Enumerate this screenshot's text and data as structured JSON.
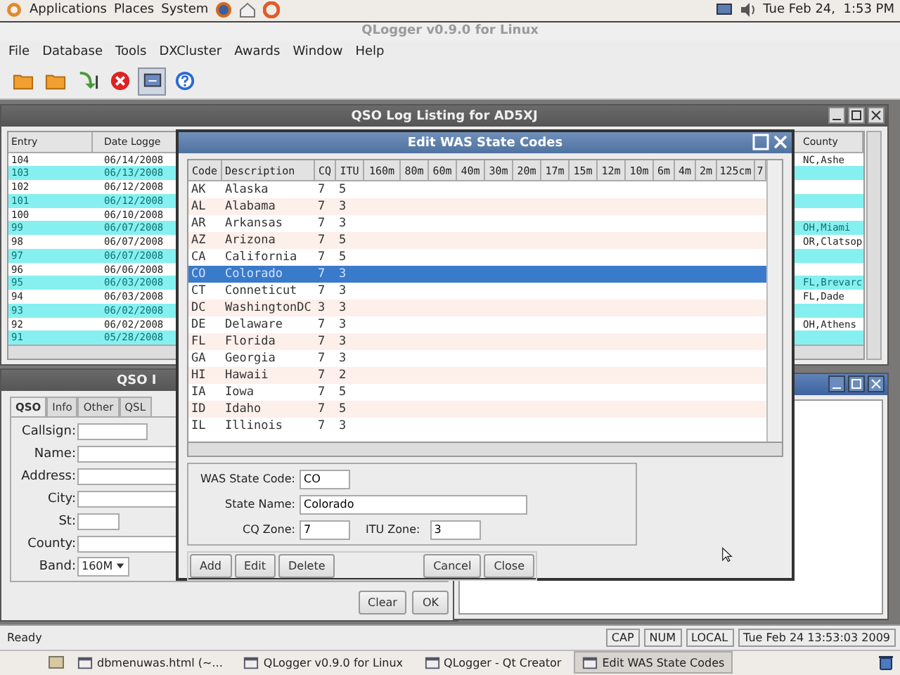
{
  "top_panel": {
    "menus": [
      "Applications",
      "Places",
      "System"
    ],
    "clock": "Tue Feb 24,  1:53 PM"
  },
  "app": {
    "title": "QLogger v0.9.0 for Linux",
    "menu": [
      "File",
      "Database",
      "Tools",
      "DXCluster",
      "Awards",
      "Window",
      "Help"
    ],
    "toolbar": [
      {
        "kind": "folder",
        "pressed": false
      },
      {
        "kind": "folder",
        "pressed": false
      },
      {
        "kind": "import",
        "pressed": false
      },
      {
        "kind": "stop",
        "pressed": false
      },
      {
        "kind": "screen",
        "pressed": true
      },
      {
        "kind": "help",
        "pressed": false
      }
    ]
  },
  "log_listing": {
    "title": "QSO Log Listing for AD5XJ",
    "columns": [
      "Entry",
      "Date Logge",
      "County"
    ],
    "rows": [
      {
        "entry": "104",
        "date": "06/14/2008",
        "county": "NC,Ashe"
      },
      {
        "entry": "103",
        "date": "06/13/2008",
        "county": ""
      },
      {
        "entry": "102",
        "date": "06/12/2008",
        "county": ""
      },
      {
        "entry": "101",
        "date": "06/12/2008",
        "county": ""
      },
      {
        "entry": "100",
        "date": "06/10/2008",
        "county": ""
      },
      {
        "entry": "99",
        "date": "06/07/2008",
        "county": "OH,Miami"
      },
      {
        "entry": "98",
        "date": "06/07/2008",
        "county": "OR,Clatsop"
      },
      {
        "entry": "97",
        "date": "06/07/2008",
        "county": ""
      },
      {
        "entry": "96",
        "date": "06/06/2008",
        "county": ""
      },
      {
        "entry": "95",
        "date": "06/03/2008",
        "county": "FL,Brevarc"
      },
      {
        "entry": "94",
        "date": "06/03/2008",
        "county": "FL,Dade"
      },
      {
        "entry": "93",
        "date": "06/02/2008",
        "county": ""
      },
      {
        "entry": "92",
        "date": "06/02/2008",
        "county": "OH,Athens"
      },
      {
        "entry": "91",
        "date": "05/28/2008",
        "county": ""
      }
    ]
  },
  "qso_window": {
    "title": "QSO I",
    "tabs": [
      {
        "label": "QSO",
        "selected": true
      },
      {
        "label": "Info",
        "selected": false
      },
      {
        "label": "Other",
        "selected": false
      },
      {
        "label": "QSL",
        "selected": false
      }
    ],
    "fields": [
      {
        "label": "Callsign:",
        "kind": "short"
      },
      {
        "label": "Name:",
        "kind": "long"
      },
      {
        "label": "Address:",
        "kind": "long"
      },
      {
        "label": "City:",
        "kind": "long"
      },
      {
        "label": "St:",
        "kind": "tiny"
      },
      {
        "label": "County:",
        "kind": "long"
      },
      {
        "label": "Band:",
        "kind": "combo",
        "value": "160M"
      }
    ],
    "buttons": [
      "Clear",
      "OK"
    ]
  },
  "was_dialog": {
    "title": "Edit WAS State Codes",
    "columns": [
      "Code",
      "Description",
      "CQ",
      "ITU",
      "160m",
      "80m",
      "60m",
      "40m",
      "30m",
      "20m",
      "17m",
      "15m",
      "12m",
      "10m",
      "6m",
      "4m",
      "2m",
      "125cm",
      "7"
    ],
    "rows": [
      {
        "code": "AK",
        "description": "Alaska",
        "cq": "7",
        "itu": "5",
        "selected": false
      },
      {
        "code": "AL",
        "description": "Alabama",
        "cq": "7",
        "itu": "3",
        "selected": false
      },
      {
        "code": "AR",
        "description": "Arkansas",
        "cq": "7",
        "itu": "3",
        "selected": false
      },
      {
        "code": "AZ",
        "description": "Arizona",
        "cq": "7",
        "itu": "5",
        "selected": false
      },
      {
        "code": "CA",
        "description": "California",
        "cq": "7",
        "itu": "5",
        "selected": false
      },
      {
        "code": "CO",
        "description": "Colorado",
        "cq": "7",
        "itu": "3",
        "selected": true
      },
      {
        "code": "CT",
        "description": "Conneticut",
        "cq": "7",
        "itu": "3",
        "selected": false
      },
      {
        "code": "DC",
        "description": "WashingtonDC",
        "cq": "3",
        "itu": "3",
        "selected": false
      },
      {
        "code": "DE",
        "description": "Delaware",
        "cq": "7",
        "itu": "3",
        "selected": false
      },
      {
        "code": "FL",
        "description": "Florida",
        "cq": "7",
        "itu": "3",
        "selected": false
      },
      {
        "code": "GA",
        "description": "Georgia",
        "cq": "7",
        "itu": "3",
        "selected": false
      },
      {
        "code": "HI",
        "description": "Hawaii",
        "cq": "7",
        "itu": "2",
        "selected": false
      },
      {
        "code": "IA",
        "description": "Iowa",
        "cq": "7",
        "itu": "5",
        "selected": false
      },
      {
        "code": "ID",
        "description": "Idaho",
        "cq": "7",
        "itu": "5",
        "selected": false
      },
      {
        "code": "IL",
        "description": "Illinois",
        "cq": "7",
        "itu": "3",
        "selected": false
      }
    ],
    "form": {
      "code_label": "WAS State Code:",
      "code": "CO",
      "name_label": "State Name:",
      "name": "Colorado",
      "cq_label": "CQ Zone:",
      "cq": "7",
      "itu_label": "ITU Zone:",
      "itu": "3"
    },
    "buttons_left": [
      "Add",
      "Edit",
      "Delete"
    ],
    "buttons_right": [
      "Cancel",
      "Close"
    ]
  },
  "status_bar": {
    "message": "Ready",
    "indicators": [
      "CAP",
      "NUM",
      "LOCAL"
    ],
    "datetime": "Tue Feb 24 13:53:03 2009"
  },
  "taskbar": [
    {
      "label": "dbmenuwas.html (~...",
      "selected": false
    },
    {
      "label": "QLogger v0.9.0 for Linux",
      "selected": false
    },
    {
      "label": "QLogger - Qt Creator",
      "selected": false
    },
    {
      "label": "Edit WAS State Codes",
      "selected": true
    }
  ]
}
